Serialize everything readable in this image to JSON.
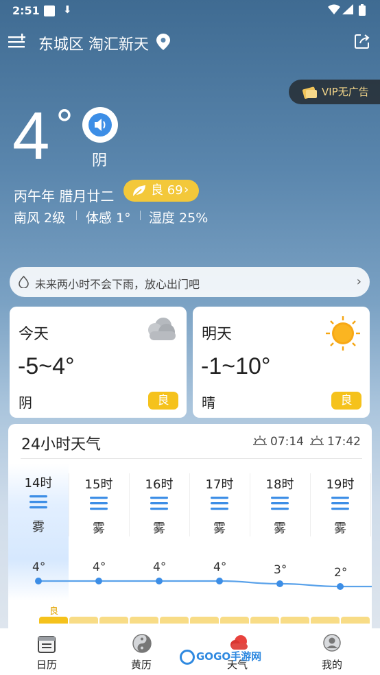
{
  "status_bar": {
    "time": "2:51"
  },
  "header": {
    "location": "东城区 淘汇新天"
  },
  "vip": {
    "label": "VIP无广告"
  },
  "current": {
    "temperature": "4",
    "degree": "°",
    "condition": "阴",
    "lunar_date": "丙午年 腊月廿二",
    "aqi_label": "良 69",
    "wind": "南风 2级",
    "feels_like": "体感 1°",
    "humidity": "湿度 25%"
  },
  "rain_notice": {
    "text": "未来两小时不会下雨，放心出门吧"
  },
  "today": {
    "label": "今天",
    "range": "-5~4°",
    "condition": "阴",
    "aqi": "良",
    "icon": "cloud-icon"
  },
  "tomorrow": {
    "label": "明天",
    "range": "-1~10°",
    "condition": "晴",
    "aqi": "良",
    "icon": "sun-icon"
  },
  "hourly": {
    "title": "24小时天气",
    "sunrise": "07:14",
    "sunset": "17:42",
    "hours": [
      {
        "hour": "14时",
        "cond": "雾",
        "temp": "4°",
        "value": 4
      },
      {
        "hour": "15时",
        "cond": "雾",
        "temp": "4°",
        "value": 4
      },
      {
        "hour": "16时",
        "cond": "雾",
        "temp": "4°",
        "value": 4
      },
      {
        "hour": "17时",
        "cond": "雾",
        "temp": "4°",
        "value": 4
      },
      {
        "hour": "18时",
        "cond": "雾",
        "temp": "3°",
        "value": 3
      },
      {
        "hour": "19时",
        "cond": "雾",
        "temp": "2°",
        "value": 2
      }
    ],
    "aqi_label": "良"
  },
  "bottom_nav": [
    {
      "label": "日历",
      "icon": "calendar-icon"
    },
    {
      "label": "黄历",
      "icon": "yin-yang-icon"
    },
    {
      "label": "天气",
      "icon": "weather-icon"
    },
    {
      "label": "我的",
      "icon": "profile-icon"
    }
  ],
  "watermark": {
    "text": "GOGO手游网"
  },
  "colors": {
    "accent": "#3d8ee6",
    "aqi_good": "#f5c21c"
  }
}
